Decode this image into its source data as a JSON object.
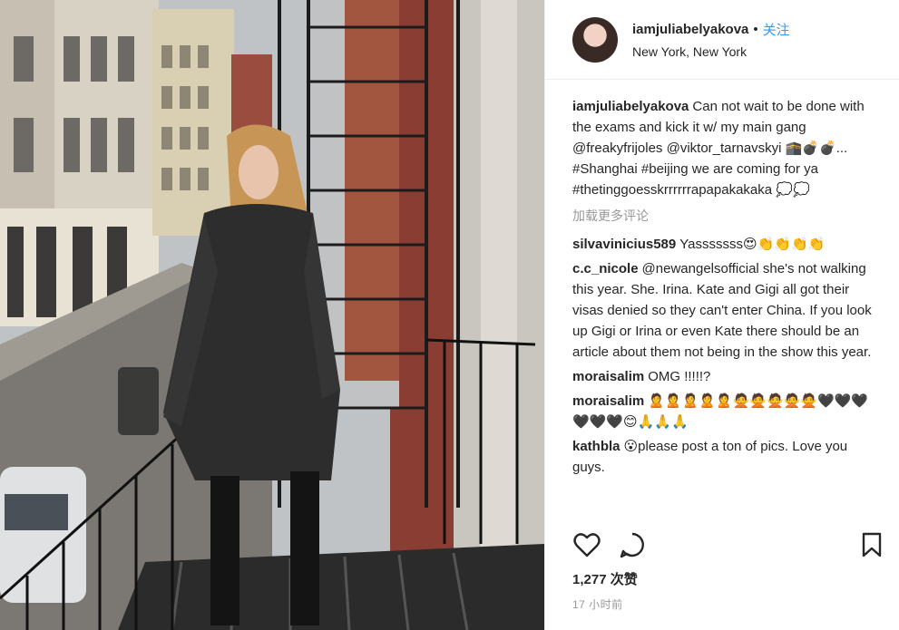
{
  "header": {
    "username": "iamjuliabelyakova",
    "separator": "•",
    "follow_label": "关注",
    "location": "New York, New York"
  },
  "caption": {
    "username": "iamjuliabelyakova",
    "text": "Can not wait to be done with the exams and kick it w/ my main gang @freakyfrijoles @viktor_tarnavskyi 🕋💣💣... #Shanghai #beijing we are coming for ya #thetinggoesskrrrrrrapapakakaka 💭💭"
  },
  "load_more": "加载更多评论",
  "comments": [
    {
      "username": "silvavinicius589",
      "text": "Yasssssss😍👏👏👏👏"
    },
    {
      "username": "c.c_nicole",
      "text": "@newangelsofficial she's not walking this year. She. Irina. Kate and Gigi all got their visas denied so they can't enter China. If you look up Gigi or Irina or even Kate there should be an article about them not being in the show this year."
    },
    {
      "username": "moraisalim",
      "text": "OMG !!!!!?"
    },
    {
      "username": "moraisalim",
      "text": "🙎🙎🙎🙎🙎🙅🙅🙅🙅🙅🖤🖤🖤🖤🖤🖤😊🙏🙏🙏"
    },
    {
      "username": "kathbla",
      "text": "😮please post a ton of pics. Love you guys."
    }
  ],
  "likes": "1,277 次赞",
  "timestamp": "17 小时前",
  "icons": {
    "like": "heart-icon",
    "comment": "comment-bubble-icon",
    "save": "bookmark-icon"
  },
  "colors": {
    "accent": "#3897f0",
    "muted": "#999999",
    "text": "#262626"
  }
}
